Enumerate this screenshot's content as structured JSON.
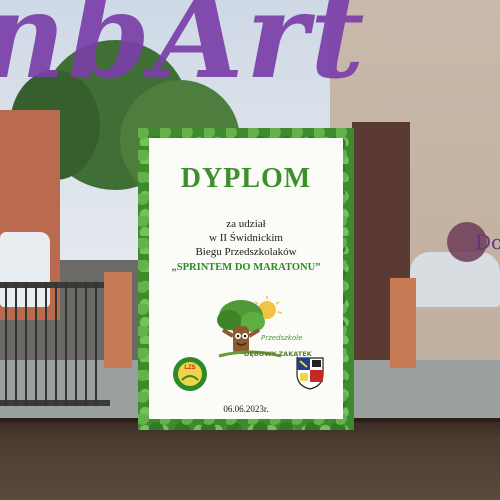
{
  "window_sticker": {
    "text": "nbArt",
    "right_logo_text": "Do"
  },
  "diploma": {
    "title": "DYPLOM",
    "line1": "za udział",
    "line2": "w II Świdnickim",
    "line3": "Biegu Przedszkolaków",
    "event": "„SPRINTEM DO MARATONU”",
    "mascot_brand_line1": "Przedszkole",
    "mascot_brand_line2": "DĘBOWY ZAKĄTEK",
    "left_crest_text": "LZS",
    "date": "06.06.2023r."
  },
  "colors": {
    "diploma_title": "#3e8f2e",
    "frame_green": "#3e8b2f",
    "sticker_purple": "#7a3fa8"
  },
  "icons": [
    "tree-mascot-icon",
    "lzs-crest-icon",
    "swidnica-coat-of-arms-icon"
  ]
}
